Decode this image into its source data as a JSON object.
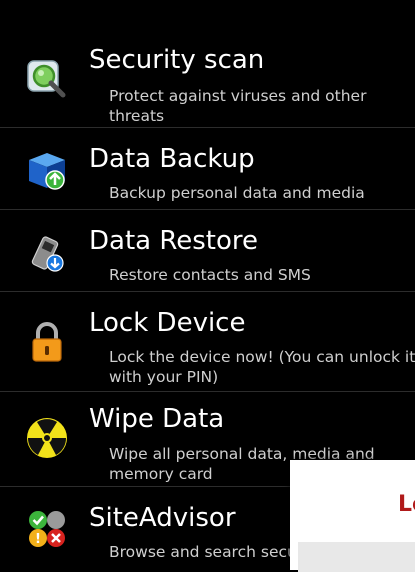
{
  "menu": {
    "items": [
      {
        "title": "Security scan",
        "description": "Protect against viruses and other threats",
        "icon": "magnifier-scan-icon"
      },
      {
        "title": "Data Backup",
        "description": "Backup personal data and media",
        "icon": "backup-cube-icon"
      },
      {
        "title": "Data Restore",
        "description": "Restore contacts and SMS",
        "icon": "restore-phone-icon"
      },
      {
        "title": "Lock Device",
        "description": "Lock the device now! (You can unlock it with your PIN)",
        "icon": "padlock-icon"
      },
      {
        "title": "Wipe Data",
        "description": "Wipe all personal data, media and memory card",
        "icon": "radiation-icon"
      },
      {
        "title": "SiteAdvisor",
        "description": "Browse and search secu",
        "icon": "siteadvisor-icon"
      }
    ]
  },
  "dialog": {
    "title_fragment": "Lo"
  }
}
